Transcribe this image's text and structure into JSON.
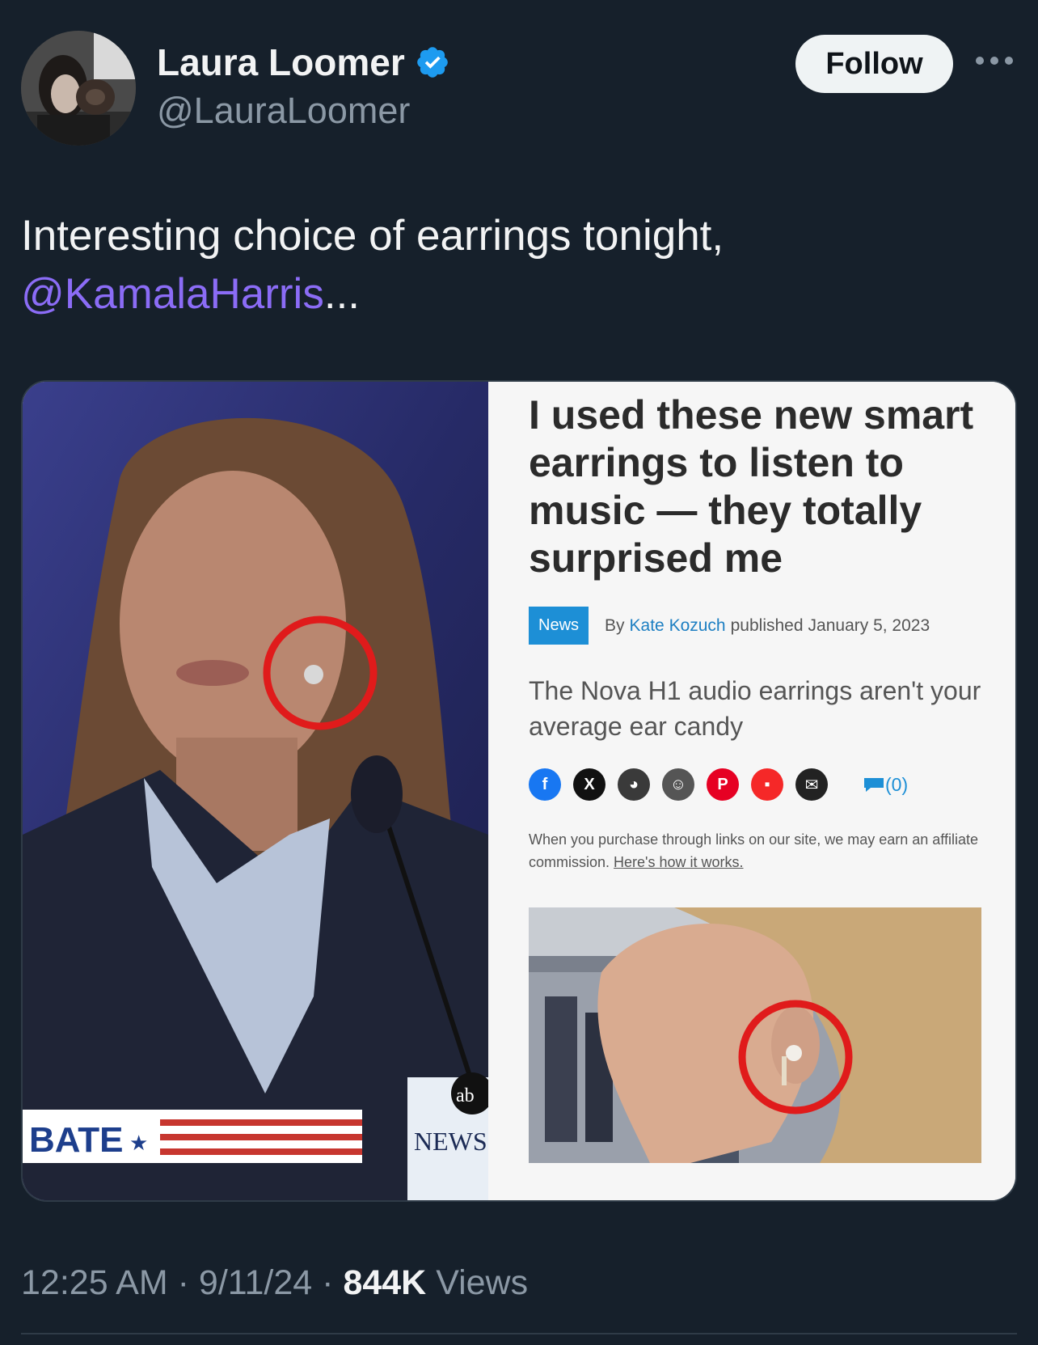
{
  "user": {
    "display_name": "Laura Loomer",
    "handle": "@LauraLoomer",
    "verified": true,
    "follow_label": "Follow"
  },
  "tweet": {
    "text_line1": "Interesting choice of earrings tonight,",
    "mention": "@KamalaHarris",
    "trailing": "..."
  },
  "media": {
    "left_image": {
      "banner_text": "BATE",
      "network_logo": "ab",
      "network_text": "NEWS"
    },
    "article": {
      "headline": "I used these new smart earrings to listen to music — they totally surprised me",
      "tag": "News",
      "by_label": "By",
      "author": "Kate Kozuch",
      "published_label": "published",
      "date": "January 5, 2023",
      "subhead": "The Nova H1 audio earrings aren't your average ear candy",
      "share_icons": [
        "facebook-icon",
        "x-icon",
        "whatsapp-icon",
        "reddit-icon",
        "pinterest-icon",
        "flipboard-icon",
        "email-icon"
      ],
      "comments_count": "(0)",
      "disclaimer": "When you purchase through links on our site, we may earn an affiliate commission.",
      "disclaimer_link": "Here's how it works."
    }
  },
  "footer": {
    "time": "12:25 AM",
    "separator": "·",
    "date": "9/11/24",
    "views_count": "844K",
    "views_label": "Views"
  },
  "colors": {
    "background": "#16202b",
    "mention": "#8b6cf6",
    "verified": "#1d9bf0",
    "highlight_circle": "#e01b1b"
  }
}
